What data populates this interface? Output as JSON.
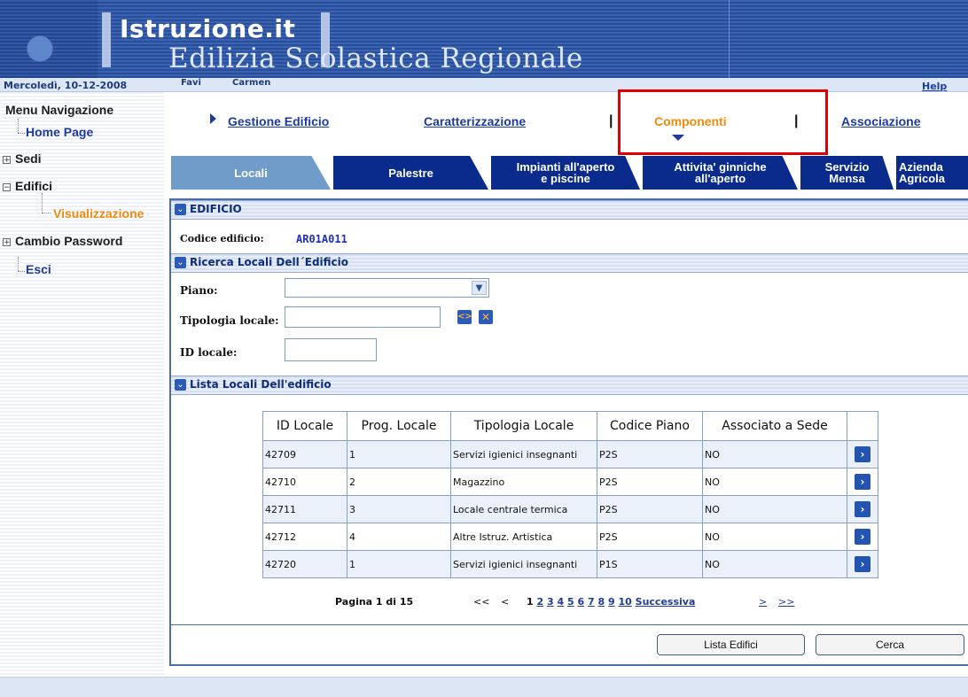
{
  "header": {
    "site_title": "Istruzione.it",
    "subtitle": "Edilizia Scolastica Regionale",
    "date": "Mercoledì, 10-12-2008",
    "user_first": "Favi",
    "user_last": "Carmen",
    "help": "Help"
  },
  "sidebar": {
    "title": "Menu Navigazione",
    "home": "Home Page",
    "sedi": "Sedi",
    "edifici": "Edifici",
    "visualizzazione": "Visualizzazione",
    "cambio_password": "Cambio Password",
    "esci": "Esci"
  },
  "topnav": {
    "gestione": "Gestione Edificio",
    "caratterizzazione": "Caratterizzazione",
    "componenti": "Componenti",
    "associazione": "Associazione"
  },
  "tabs": {
    "locali": "Locali",
    "palestre": "Palestre",
    "impianti_1": "Impianti all'aperto",
    "impianti_2": "e piscine",
    "attivita_1": "Attivita' ginniche",
    "attivita_2": "all'aperto",
    "servizio_1": "Servizio",
    "servizio_2": "Mensa",
    "azienda_1": "Azienda",
    "azienda_2": "Agricola"
  },
  "edificio": {
    "section": "EDIFICIO",
    "code_label": "Codice edificio:",
    "code_value": "AR01A011"
  },
  "ricerca": {
    "section": "Ricerca Locali Dell´Edificio",
    "piano_label": "Piano:",
    "tipologia_label": "Tipologia locale:",
    "id_label": "ID locale:"
  },
  "lista": {
    "section": "Lista Locali Dell'edificio",
    "headers": [
      "ID Locale",
      "Prog. Locale",
      "Tipologia Locale",
      "Codice Piano",
      "Associato a Sede"
    ],
    "rows": [
      [
        "42709",
        "1",
        "Servizi igienici insegnanti",
        "P2S",
        "NO"
      ],
      [
        "42710",
        "2",
        "Magazzino",
        "P2S",
        "NO"
      ],
      [
        "42711",
        "3",
        "Locale centrale termica",
        "P2S",
        "NO"
      ],
      [
        "42712",
        "4",
        "Altre Istruz. Artistica",
        "P2S",
        "NO"
      ],
      [
        "42720",
        "1",
        "Servizi igienici insegnanti",
        "P1S",
        "NO"
      ]
    ]
  },
  "pager": {
    "page_info": "Pagina 1 di 15",
    "first": "<<",
    "prev": "<",
    "current": "1",
    "pages": [
      "2",
      "3",
      "4",
      "5",
      "6",
      "7",
      "8",
      "9",
      "10"
    ],
    "next_word": "Successiva",
    "next": ">",
    "last": ">>"
  },
  "buttons": {
    "lista_edifici": "Lista Edifici",
    "cerca": "Cerca"
  },
  "colors": {
    "banner": "#2a4f9a",
    "tab": "#0a2a8c",
    "tab_active": "#6f9cc8",
    "link": "#1d3b9a",
    "accent_orange": "#f08a0c",
    "highlight_red": "#e10000"
  }
}
